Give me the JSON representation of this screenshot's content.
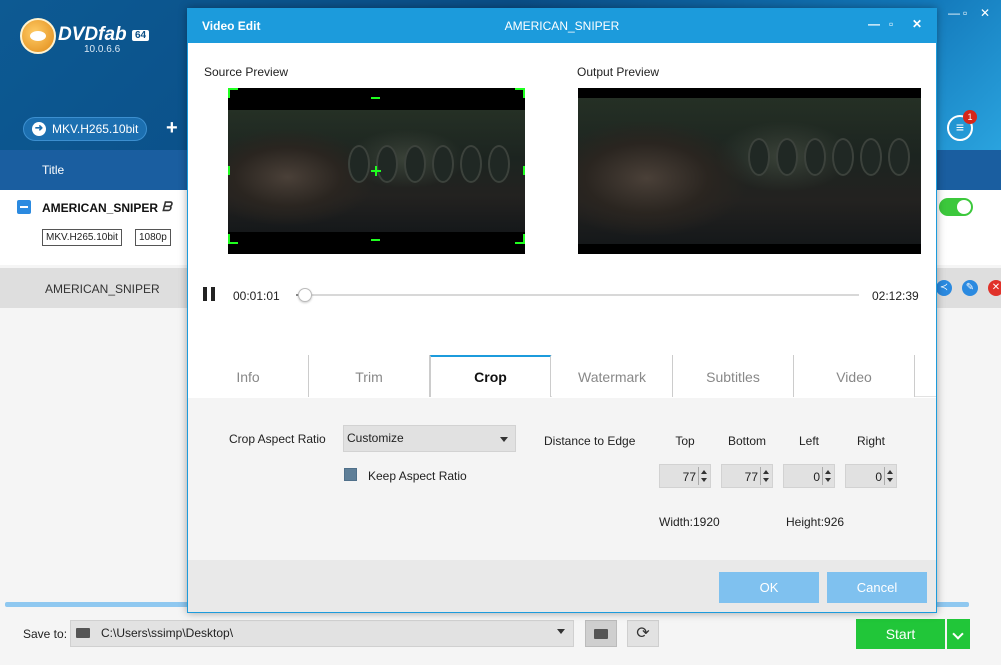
{
  "app": {
    "name": "DVDfab",
    "bits": "64",
    "version": "10.0.6.6",
    "profile": "MKV.H265.10bit",
    "queue_count": "1",
    "column_title": "Title"
  },
  "titles": [
    {
      "name": "AMERICAN_SNIPER",
      "codec_tag": "MKV.H265.10bit",
      "res_tag": "1080p"
    },
    {
      "name": "AMERICAN_SNIPER"
    }
  ],
  "footer": {
    "save_label": "Save to:",
    "save_path": "C:\\Users\\ssimp\\Desktop\\",
    "start_label": "Start"
  },
  "dialog": {
    "title": "Video Edit",
    "subtitle": "AMERICAN_SNIPER",
    "source_label": "Source Preview",
    "output_label": "Output Preview",
    "time_current": "00:01:01",
    "time_total": "02:12:39",
    "seek_fraction": 0.01,
    "tabs": [
      {
        "label": "Info"
      },
      {
        "label": "Trim"
      },
      {
        "label": "Crop"
      },
      {
        "label": "Watermark"
      },
      {
        "label": "Subtitles"
      },
      {
        "label": "Video"
      }
    ],
    "active_tab": "Crop",
    "crop": {
      "aspect_label": "Crop Aspect Ratio",
      "aspect_value": "Customize",
      "keep_aspect_label": "Keep Aspect Ratio",
      "distance_label": "Distance to Edge",
      "edges": {
        "top": {
          "label": "Top",
          "value": "77"
        },
        "bottom": {
          "label": "Bottom",
          "value": "77"
        },
        "left": {
          "label": "Left",
          "value": "0"
        },
        "right": {
          "label": "Right",
          "value": "0"
        }
      },
      "width_text": "Width:1920",
      "height_text": "Height:926"
    },
    "ok_label": "OK",
    "cancel_label": "Cancel"
  },
  "colors": {
    "accent": "#1c9bdc",
    "start_green": "#21c639",
    "crop_guide": "#1fff1f",
    "remove_red": "#e0322a"
  }
}
